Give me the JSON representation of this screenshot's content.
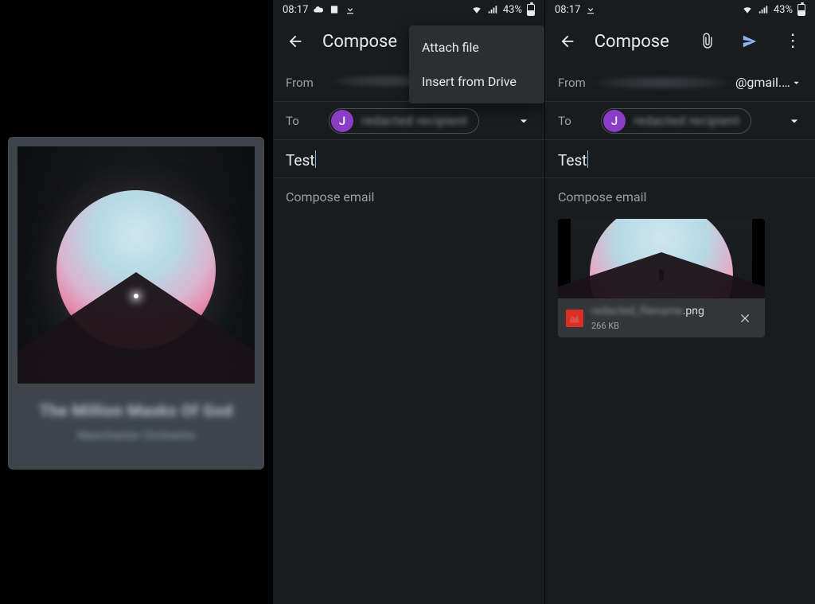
{
  "left_panel": {
    "album_title_blurred": "The Million Masks Of God",
    "artist_blurred": "Manchester Orchestra"
  },
  "status": {
    "time": "08:17",
    "battery_text": "43%"
  },
  "compose": {
    "title": "Compose",
    "from_label": "From",
    "to_label": "To",
    "subject": "Test",
    "body_placeholder": "Compose email",
    "recipient_initial": "J",
    "recipient_name_blurred": "redacted recipient",
    "from_address_blurred": "redacted sender",
    "from_address_visible_suffix": "@gmail.…"
  },
  "attach_menu": {
    "attach_file": "Attach file",
    "insert_drive": "Insert from Drive"
  },
  "attachment": {
    "filename_blurred": "redacted_filename",
    "ext": ".png",
    "size": "266 KB"
  }
}
